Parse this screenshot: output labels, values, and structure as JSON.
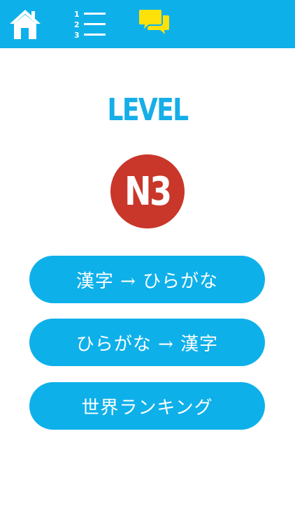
{
  "nav": {
    "home_icon": "home-icon",
    "list_icon": "numbered-list-icon",
    "list_numbers": [
      "1",
      "2",
      "3"
    ],
    "chat_icon": "chat-bubbles-icon"
  },
  "level": {
    "title": "LEVEL",
    "badge": "N3"
  },
  "menu": {
    "kanji_to_hiragana": "漢字 → ひらがな",
    "hiragana_to_kanji": "ひらがな → 漢字",
    "world_ranking": "世界ランキング"
  },
  "colors": {
    "accent": "#0eb0ea",
    "badge": "#c9362a",
    "chat_icon": "#ffe10a"
  }
}
